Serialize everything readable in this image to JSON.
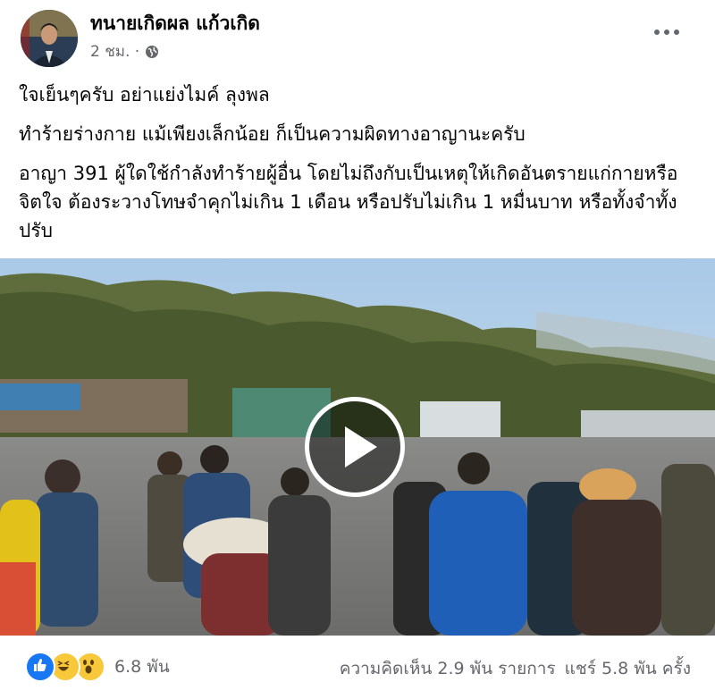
{
  "post": {
    "author_name": "ทนายเกิดผล แก้วเกิด",
    "timestamp": "2 ชม. ·",
    "privacy_icon": "globe-icon",
    "more_icon": "more-options-icon",
    "lines": [
      "ใจเย็นๆครับ อย่าแย่งไมค์ ลุงพล",
      "ทำร้ายร่างกาย แม้เพียงเล็กน้อย ก็เป็นความผิดทางอาญานะครับ",
      "อาญา 391 ผู้ใดใช้กำลังทำร้ายผู้อื่น โดยไม่ถึงกับเป็นเหตุให้เกิดอันตรายแก่กายหรือจิตใจ ต้องระวางโทษจำคุกไม่เกิน 1 เดือน หรือปรับไม่เกิน 1 หมื่นบาท หรือทั้งจำทั้งปรับ"
    ],
    "video": {
      "play_icon": "play-icon"
    }
  },
  "footer": {
    "reactions": [
      "like-icon",
      "haha-icon",
      "wow-icon"
    ],
    "reaction_count": "6.8 พัน",
    "comments": "ความคิดเห็น 2.9 พัน รายการ",
    "shares": "แชร์ 5.8 พัน ครั้ง"
  },
  "colors": {
    "like": "#1877f2",
    "emoji": "#f7c93a",
    "muted_text": "#65676b"
  }
}
